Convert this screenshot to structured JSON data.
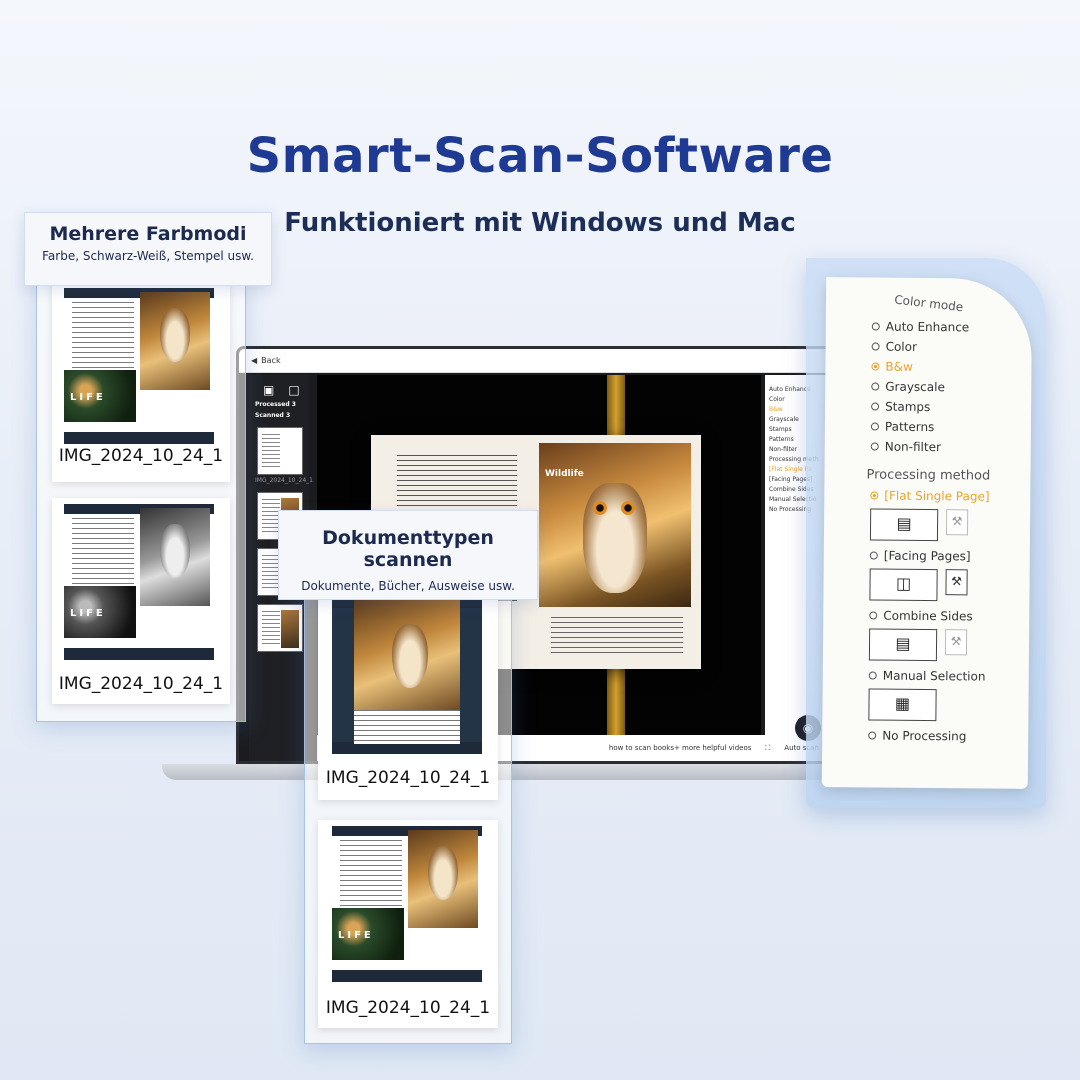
{
  "headline": "Smart-Scan-Software",
  "subhead": "Funktioniert mit Windows und Mac",
  "callouts": {
    "color_modes": {
      "title": "Mehrere Farbmodi",
      "subtitle": "Farbe, Schwarz-Weiß, Stempel usw."
    },
    "doc_types": {
      "title": "Dokumenttypen scannen",
      "subtitle": "Dokumente, Bücher, Ausweise usw."
    }
  },
  "thumbnails": [
    {
      "caption": "IMG_2024_10_24_1"
    },
    {
      "caption": "IMG_2024_10_24_1"
    },
    {
      "caption": "IMG_2024_10_24_1"
    },
    {
      "caption": "IMG_2024_10_24_1"
    }
  ],
  "app": {
    "back_label": "Back",
    "processed_label": "Processed",
    "processed_count": "3",
    "scanned_label": "Scanned",
    "scanned_count": "3",
    "side_caption": "IMG_2024_10_24_1",
    "book_photo_title": "Wildlife",
    "options": [
      "Auto Enhance",
      "Color",
      "B&w",
      "Grayscale",
      "Stamps",
      "Patterns",
      "Non-filter"
    ],
    "processing_label": "Processing meth",
    "processing_options": [
      "[Flat Single Pa",
      "[Facing Pages]",
      "Combine Sides",
      "Manual Selectio",
      "No Processing"
    ],
    "help_link": "how to scan books+ more helpful videos",
    "auto_scan": "Auto scan"
  },
  "paper_panel": {
    "color_mode_title": "Color mode",
    "color_options": [
      {
        "label": "Auto Enhance",
        "selected": false
      },
      {
        "label": "Color",
        "selected": false
      },
      {
        "label": "B&w",
        "selected": true
      },
      {
        "label": "Grayscale",
        "selected": false
      },
      {
        "label": "Stamps",
        "selected": false
      },
      {
        "label": "Patterns",
        "selected": false
      },
      {
        "label": "Non-filter",
        "selected": false
      }
    ],
    "processing_title": "Processing method",
    "processing_options": [
      {
        "label": "[Flat Single Page]",
        "selected": true
      },
      {
        "label": "[Facing Pages]",
        "selected": false
      },
      {
        "label": "Combine Sides",
        "selected": false
      },
      {
        "label": "Manual Selection",
        "selected": false
      },
      {
        "label": "No Processing",
        "selected": false
      }
    ]
  },
  "colors": {
    "headline": "#1f3a93",
    "accent": "#e6a42c"
  }
}
